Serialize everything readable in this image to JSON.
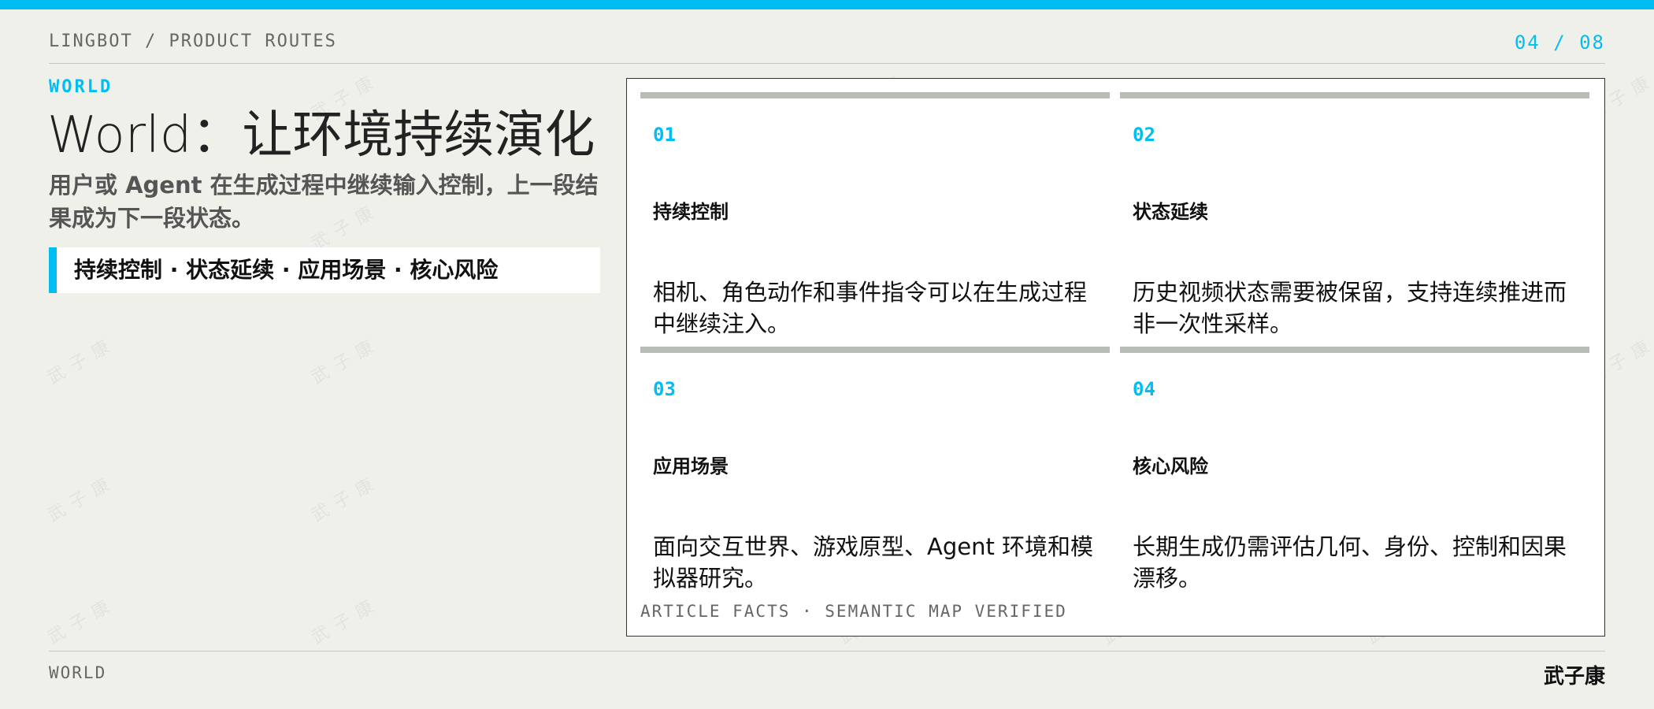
{
  "header": {
    "breadcrumb": "LINGBOT / PRODUCT ROUTES",
    "page_indicator": "04 / 08"
  },
  "main": {
    "eyebrow": "WORLD",
    "title": "World：让环境持续演化",
    "subtitle": "用户或 Agent 在生成过程中继续输入控制，上一段结果成为下一段状态。",
    "tag_summary": "持续控制 · 状态延续 · 应用场景 · 核心风险"
  },
  "panel": {
    "cards": [
      {
        "num": "01",
        "label": "持续控制",
        "desc": "相机、角色动作和事件指令可以在生成过程中继续注入。"
      },
      {
        "num": "02",
        "label": "状态延续",
        "desc": "历史视频状态需要被保留，支持连续推进而非一次性采样。"
      },
      {
        "num": "03",
        "label": "应用场景",
        "desc": "面向交互世界、游戏原型、Agent 环境和模拟器研究。"
      },
      {
        "num": "04",
        "label": "核心风险",
        "desc": "长期生成仍需评估几何、身份、控制和因果漂移。"
      }
    ],
    "footer": "ARTICLE FACTS · SEMANTIC MAP VERIFIED"
  },
  "footer": {
    "section": "WORLD",
    "author": "武子康"
  },
  "watermark": "武子康",
  "colors": {
    "accent": "#00bdf2",
    "background": "#f0f0eb",
    "card_bar": "#b7bdb5"
  }
}
